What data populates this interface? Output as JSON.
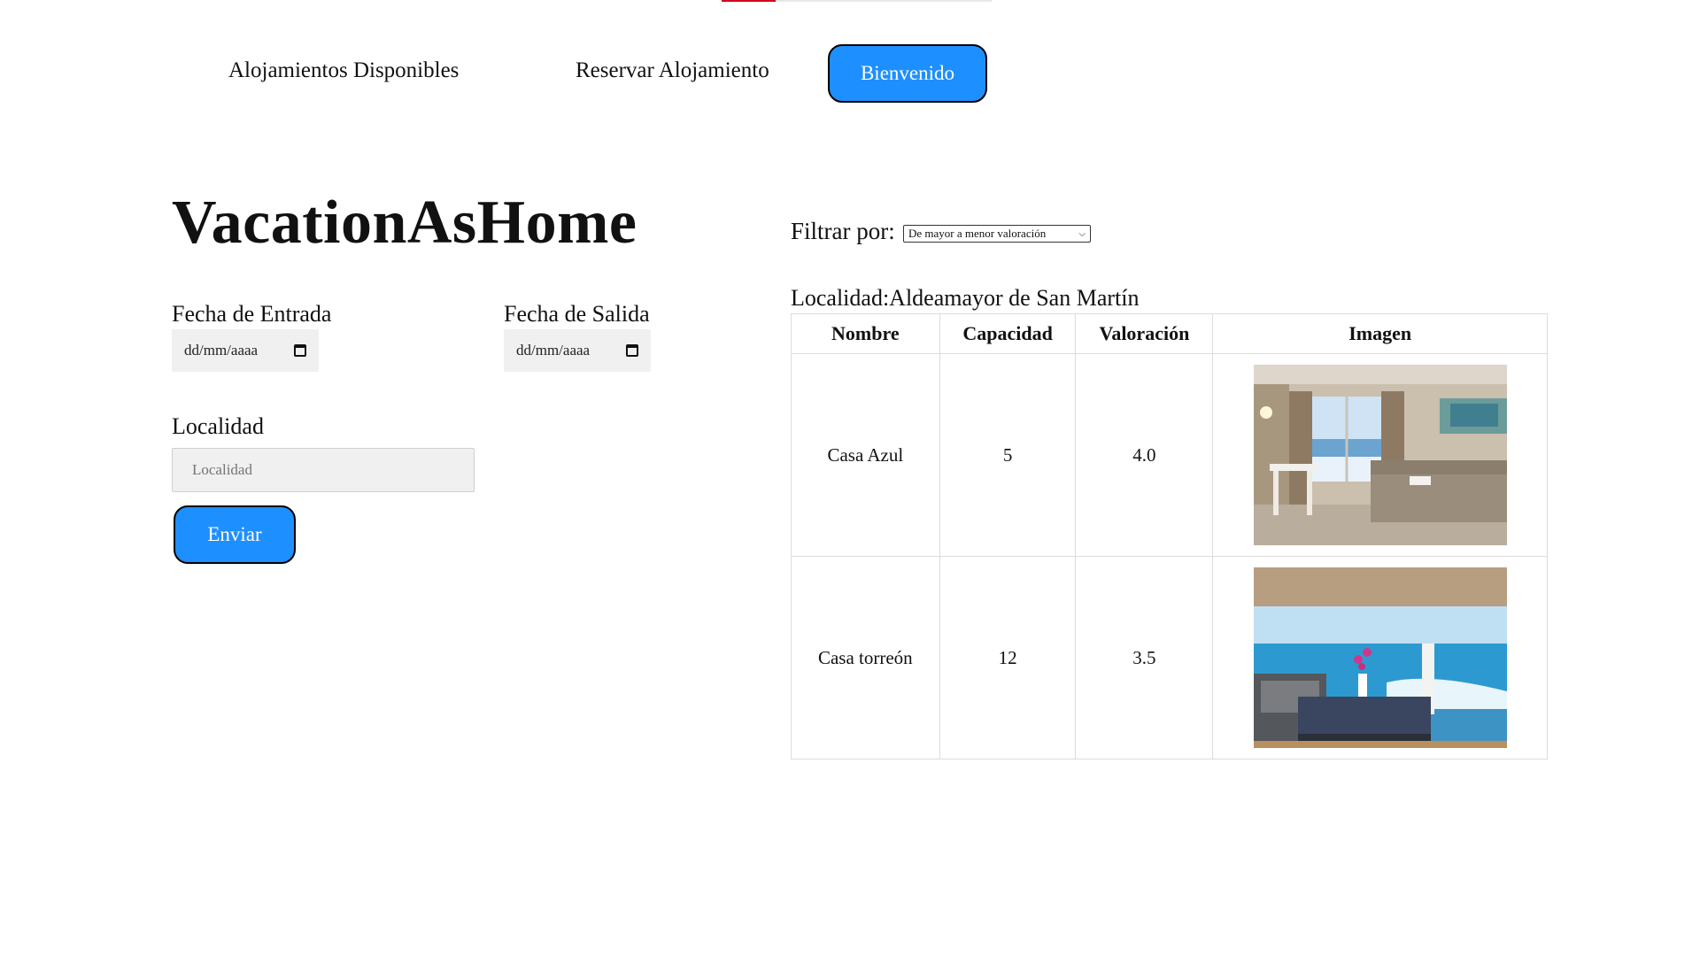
{
  "nav": {
    "link_available": "Alojamientos Disponibles",
    "link_reserve": "Reservar Alojamiento",
    "welcome_button": "Bienvenido"
  },
  "search": {
    "title": "VacationAsHome",
    "checkin_label": "Fecha de Entrada",
    "checkin_value": "dd/mm/aaaa",
    "checkout_label": "Fecha de Salida",
    "checkout_value": "dd/mm/aaaa",
    "locality_label": "Localidad",
    "locality_placeholder": "Localidad",
    "submit_label": "Enviar"
  },
  "results": {
    "filter_label": "Filtrar por:",
    "filter_selected": "De mayor a menor valoración",
    "locality_caption": "Localidad:Aldeamayor de San Martín",
    "columns": [
      "Nombre",
      "Capacidad",
      "Valoración",
      "Imagen"
    ],
    "rows": [
      {
        "name": "Casa Azul",
        "capacity": "5",
        "rating": "4.0",
        "image": "hotel-bedroom-sea-view-photo"
      },
      {
        "name": "Casa torreón",
        "capacity": "12",
        "rating": "3.5",
        "image": "terrace-sea-view-photo"
      }
    ]
  },
  "colors": {
    "accent": "#1e8fff",
    "input_bg": "#f0f0f0",
    "table_border": "#dcdcdc"
  }
}
